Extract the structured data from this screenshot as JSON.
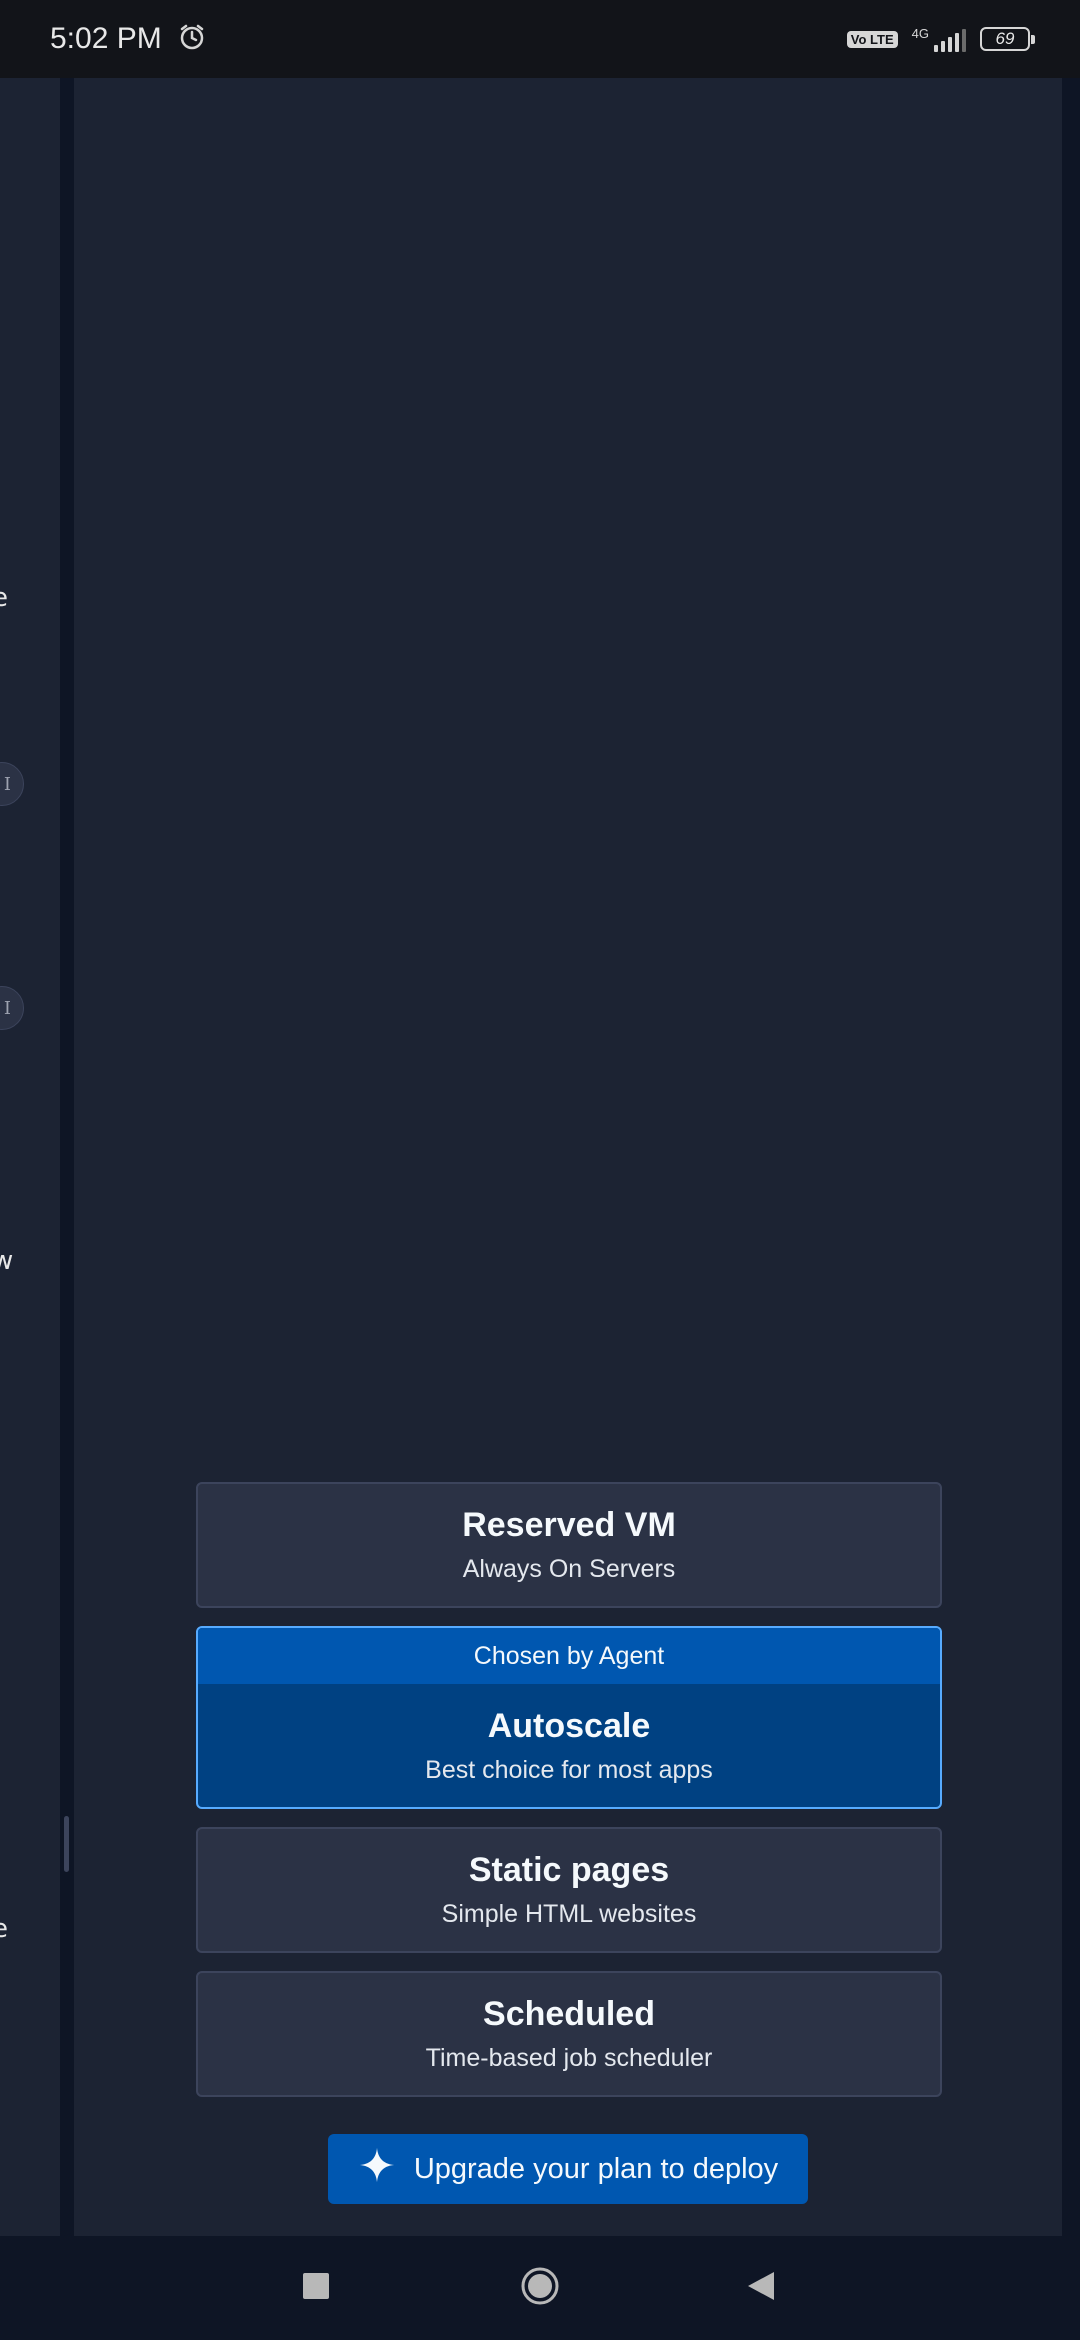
{
  "status_bar": {
    "time": "5:02 PM",
    "network": "4G",
    "volte": "Vo LTE",
    "battery": "69"
  },
  "left_panel": {
    "fragments": [
      "e",
      "I",
      "I",
      "w",
      "e"
    ]
  },
  "deployment_options": [
    {
      "title": "Reserved VM",
      "subtitle": "Always On Servers"
    },
    {
      "badge": "Chosen by Agent",
      "title": "Autoscale",
      "subtitle": "Best choice for most apps"
    },
    {
      "title": "Static pages",
      "subtitle": "Simple HTML websites"
    },
    {
      "title": "Scheduled",
      "subtitle": "Time-based job scheduler"
    }
  ],
  "upgrade_button": {
    "label": "Upgrade your plan to deploy",
    "icon": "sparkle-icon"
  },
  "nav_bar": {
    "icons": [
      "recent-apps-icon",
      "home-icon",
      "back-icon"
    ]
  },
  "colors": {
    "background": "#1c2333",
    "card": "#2b3245",
    "selected": "#004182",
    "accent": "#0057b0",
    "selected_border": "#57abff"
  }
}
